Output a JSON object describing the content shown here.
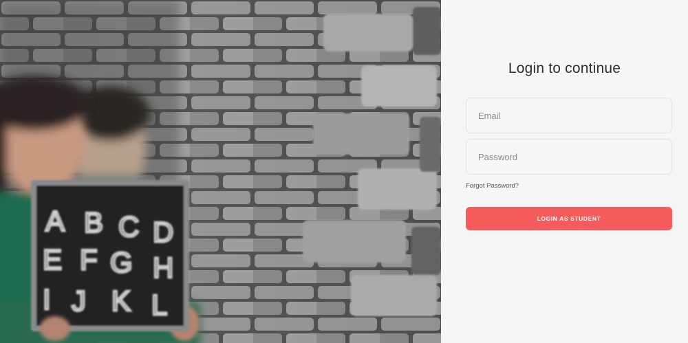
{
  "hero": {
    "image": "children-holding-chalkboard-photo",
    "chalkboard_letters": [
      "A",
      "B",
      "C",
      "D",
      "E",
      "F",
      "G",
      "H",
      "I",
      "J",
      "K",
      "L"
    ]
  },
  "login": {
    "title": "Login to continue",
    "email_placeholder": "Email",
    "password_placeholder": "Password",
    "forgot_password": "Forgot Password?",
    "submit_label": "LOGIN AS STUDENT"
  },
  "colors": {
    "accent": "#f55b5b",
    "panel_background": "#f6f6f6",
    "field_border": "#e3e3e3",
    "title_text": "#2f2f2f"
  }
}
